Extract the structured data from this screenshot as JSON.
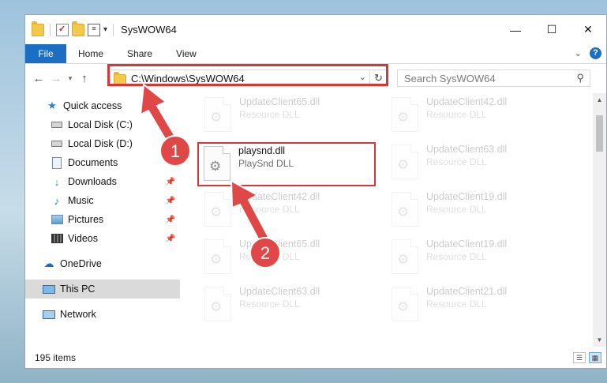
{
  "window": {
    "title": "SysWOW64"
  },
  "quick_access_toolbar": {
    "icons": [
      "folder-icon",
      "properties-icon",
      "new-folder-icon",
      "view-icon"
    ],
    "dropdown": "▾"
  },
  "window_controls": {
    "minimize": "—",
    "maximize": "☐",
    "close": "✕"
  },
  "ribbon": {
    "tabs": [
      "File",
      "Home",
      "Share",
      "View"
    ],
    "help": "?"
  },
  "address_bar": {
    "path": "C:\\Windows\\SysWOW64"
  },
  "search": {
    "placeholder": "Search SysWOW64"
  },
  "nav_pane": {
    "items": [
      {
        "label": "Quick access",
        "icon": "star-icon",
        "pinned": false
      },
      {
        "label": "Local Disk (C:)",
        "icon": "drive-icon",
        "pinned": false
      },
      {
        "label": "Local Disk (D:)",
        "icon": "drive-icon",
        "pinned": false
      },
      {
        "label": "Documents",
        "icon": "documents-icon",
        "pinned": false
      },
      {
        "label": "Downloads",
        "icon": "downloads-icon",
        "pinned": true
      },
      {
        "label": "Music",
        "icon": "music-icon",
        "pinned": true
      },
      {
        "label": "Pictures",
        "icon": "pictures-icon",
        "pinned": true
      },
      {
        "label": "Videos",
        "icon": "videos-icon",
        "pinned": true
      },
      {
        "label": "OneDrive",
        "icon": "onedrive-icon",
        "pinned": false
      },
      {
        "label": "This PC",
        "icon": "this-pc-icon",
        "pinned": false,
        "selected": true
      },
      {
        "label": "Network",
        "icon": "network-icon",
        "pinned": false
      }
    ]
  },
  "files": [
    {
      "name": "UpdateClient65.dll",
      "type": "Resource DLL",
      "highlighted": false
    },
    {
      "name": "UpdateClient42.dll",
      "type": "Resource DLL",
      "highlighted": false
    },
    {
      "name": "playsnd.dll",
      "type": "PlaySnd DLL",
      "highlighted": true
    },
    {
      "name": "UpdateClient63.dll",
      "type": "Resource DLL",
      "highlighted": false
    },
    {
      "name": "UpdateClient42.dll",
      "type": "Resource DLL",
      "highlighted": false
    },
    {
      "name": "UpdateClient19.dll",
      "type": "Resource DLL",
      "highlighted": false
    },
    {
      "name": "UpdateClient65.dll",
      "type": "Resource DLL",
      "highlighted": false
    },
    {
      "name": "UpdateClient19.dll",
      "type": "Resource DLL",
      "highlighted": false
    },
    {
      "name": "UpdateClient63.dll",
      "type": "Resource DLL",
      "highlighted": false
    },
    {
      "name": "UpdateClient21.dll",
      "type": "Resource DLL",
      "highlighted": false
    }
  ],
  "status": {
    "item_count": "195 items"
  },
  "annotations": {
    "step1": "1",
    "step2": "2",
    "color": "#d23a3a"
  }
}
